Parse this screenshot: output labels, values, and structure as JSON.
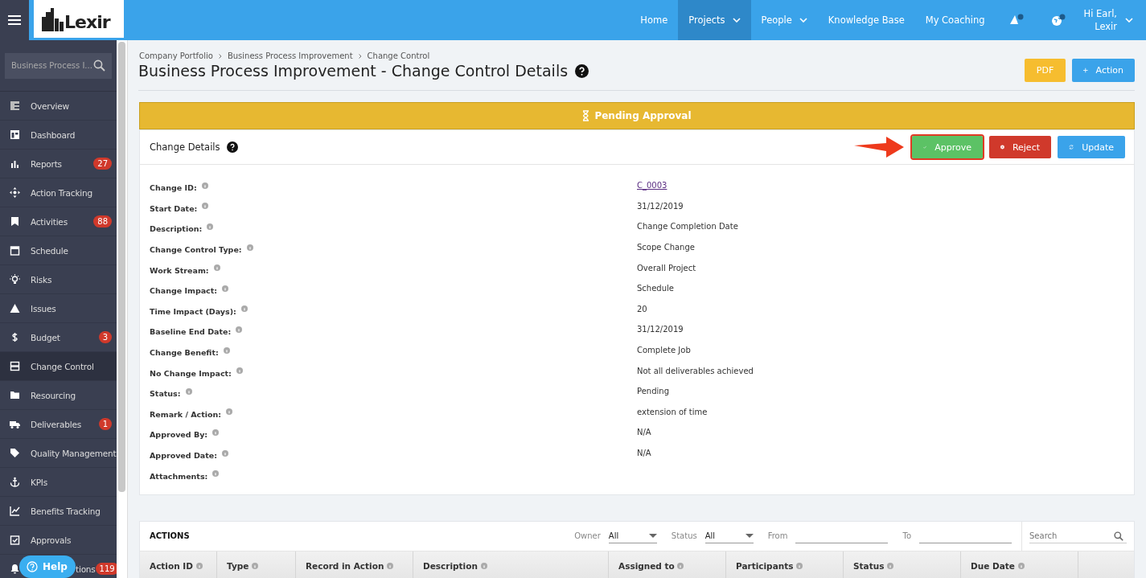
{
  "logo": {
    "text": "Lexir"
  },
  "nav": [
    {
      "label": "Home",
      "selected": false,
      "dropdown": false
    },
    {
      "label": "Projects",
      "selected": true,
      "dropdown": true
    },
    {
      "label": "People",
      "selected": false,
      "dropdown": true
    },
    {
      "label": "Knowledge Base",
      "selected": false,
      "dropdown": false
    },
    {
      "label": "My Coaching",
      "selected": false,
      "dropdown": false
    }
  ],
  "user": {
    "greeting": "Hi Earl,",
    "name": "Lexir"
  },
  "sidebar": {
    "search": {
      "value": "Business Process I..."
    },
    "items": [
      {
        "label": "Overview",
        "selected": false
      },
      {
        "label": "Dashboard",
        "selected": false
      },
      {
        "label": "Reports",
        "selected": false,
        "badge": "27"
      },
      {
        "label": "Action Tracking",
        "selected": false
      },
      {
        "label": "Activities",
        "selected": false,
        "badge": "88"
      },
      {
        "label": "Schedule",
        "selected": false
      },
      {
        "label": "Risks",
        "selected": false
      },
      {
        "label": "Issues",
        "selected": false
      },
      {
        "label": "Budget",
        "selected": false,
        "badge": "3"
      },
      {
        "label": "Change Control",
        "selected": true
      },
      {
        "label": "Resourcing",
        "selected": false
      },
      {
        "label": "Deliverables",
        "selected": false,
        "badge": "1"
      },
      {
        "label": "Quality Management",
        "selected": false
      },
      {
        "label": "KPIs",
        "selected": false
      },
      {
        "label": "Benefits Tracking",
        "selected": false
      },
      {
        "label": "Approvals",
        "selected": false
      },
      {
        "label": "tions",
        "selected": false,
        "badge": "119",
        "covered": true
      }
    ],
    "help": "Help"
  },
  "breadcrumb": [
    "Company Portfolio",
    "Business Process Improvement",
    "Change Control"
  ],
  "title": "Business Process Improvement - Change Control Details",
  "header_buttons": [
    {
      "label": "PDF",
      "kind": "pdf"
    },
    {
      "label": "Action",
      "kind": "add"
    }
  ],
  "status_banner": "Pending Approval",
  "details": {
    "title": "Change Details",
    "buttons": [
      {
        "label": "Approve",
        "kind": "approve",
        "highlighted": true
      },
      {
        "label": "Reject",
        "kind": "reject",
        "highlighted": false
      },
      {
        "label": "Update",
        "kind": "update",
        "highlighted": false
      }
    ],
    "fields": [
      {
        "label": "Change ID:",
        "value": "C_0003",
        "link": true
      },
      {
        "label": "Start Date:",
        "value": "31/12/2019",
        "link": false
      },
      {
        "label": "Description:",
        "value": "Change Completion Date",
        "link": false
      },
      {
        "label": "Change Control Type:",
        "value": "Scope Change",
        "link": false
      },
      {
        "label": "Work Stream:",
        "value": "Overall Project",
        "link": false
      },
      {
        "label": "Change Impact:",
        "value": "Schedule",
        "link": false
      },
      {
        "label": "Time Impact (Days):",
        "value": "20",
        "link": false
      },
      {
        "label": "Baseline End Date:",
        "value": "31/12/2019",
        "link": false
      },
      {
        "label": "Change Benefit:",
        "value": "Complete Job",
        "link": false
      },
      {
        "label": "No Change Impact:",
        "value": "Not all deliverables achieved",
        "link": false
      },
      {
        "label": "Status:",
        "value": "Pending",
        "link": false
      },
      {
        "label": "Remark / Action:",
        "value": "extension of time",
        "link": false
      },
      {
        "label": "Approved By:",
        "value": "N/A",
        "link": false
      },
      {
        "label": "Approved Date:",
        "value": "N/A",
        "link": false
      },
      {
        "label": "Attachments:"
      }
    ]
  },
  "actions": {
    "title": "ACTIONS",
    "filters": [
      {
        "label": "Owner",
        "value": "All",
        "kind": "select"
      },
      {
        "label": "Status",
        "value": "All",
        "kind": "select"
      },
      {
        "label": "From",
        "kind": "date"
      },
      {
        "label": "To",
        "kind": "date"
      }
    ],
    "search": {
      "placeholder": "Search"
    },
    "columns": [
      "Action ID",
      "Type",
      "Record in Action",
      "Description",
      "Assigned to",
      "Participants",
      "Status",
      "Due Date"
    ]
  }
}
